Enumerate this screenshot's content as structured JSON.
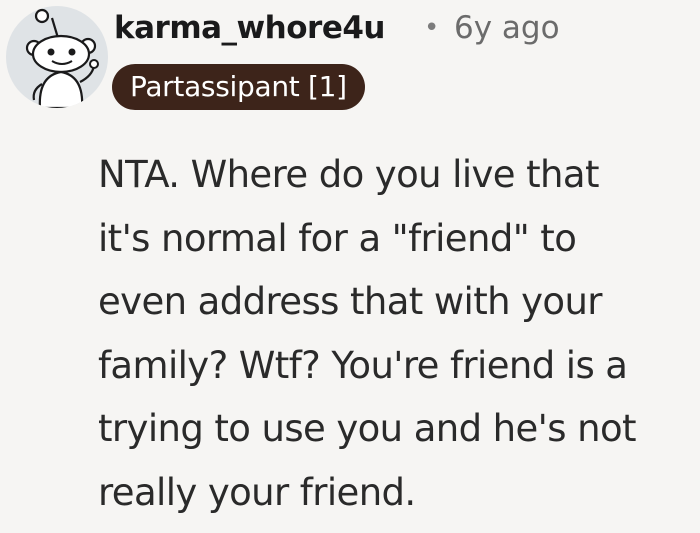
{
  "comment": {
    "avatar_icon": "snoo-avatar-icon",
    "username": "karma_whore4u",
    "separator": "•",
    "timestamp": "6y ago",
    "flair": "Partassipant [1]",
    "flair_color": "#3d241a",
    "body_lines": [
      "NTA. Where do you live that",
      "it's normal for a \"friend\" to",
      "even address that with your",
      "family? Wtf? You're friend is a",
      "trying to use you and he's not",
      "really your friend."
    ]
  }
}
